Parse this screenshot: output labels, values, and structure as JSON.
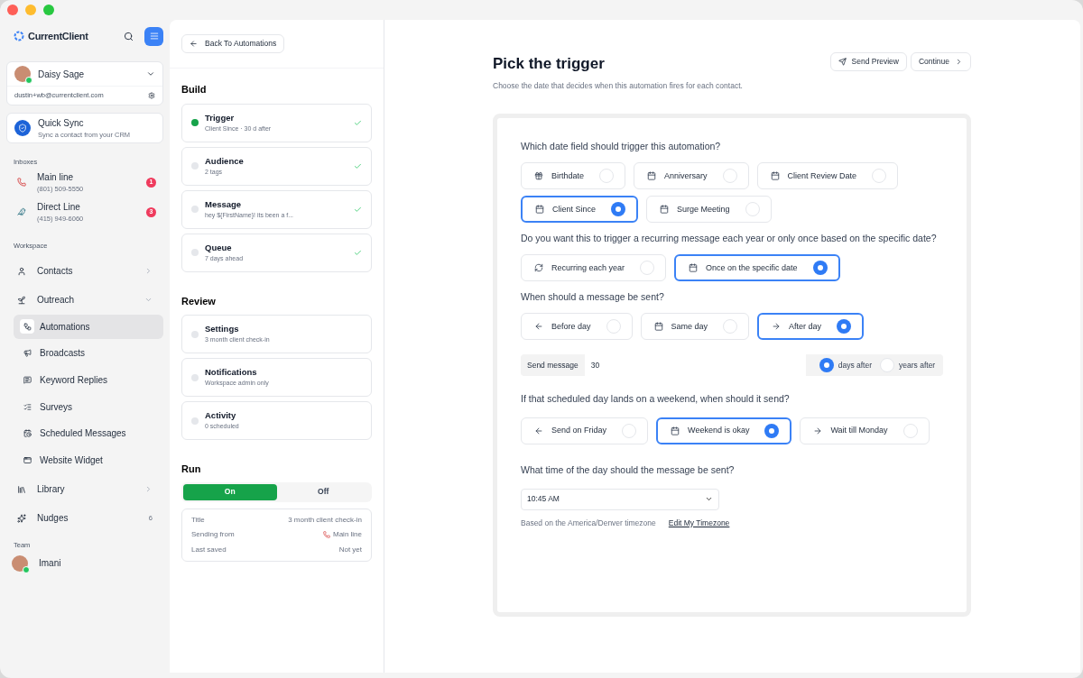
{
  "brand": {
    "name": "CurrentClient"
  },
  "account": {
    "name": "Daisy Sage",
    "email": "dustin+wb@currentclient.com",
    "online": true
  },
  "quick_sync": {
    "title": "Quick Sync",
    "subtitle": "Sync a contact from your CRM"
  },
  "inboxes": {
    "heading": "Inboxes",
    "items": [
      {
        "name": "Main line",
        "phone": "(801) 509-5550",
        "count": "1"
      },
      {
        "name": "Direct Line",
        "phone": "(415) 949-6060",
        "count": "3"
      }
    ]
  },
  "workspace": {
    "heading": "Workspace",
    "items": [
      {
        "label": "Contacts",
        "expanded": false
      },
      {
        "label": "Outreach",
        "expanded": true,
        "children": [
          {
            "label": "Automations",
            "selected": true
          },
          {
            "label": "Broadcasts",
            "selected": false
          },
          {
            "label": "Keyword Replies",
            "selected": false
          },
          {
            "label": "Surveys",
            "selected": false
          },
          {
            "label": "Scheduled Messages",
            "selected": false
          },
          {
            "label": "Website Widget",
            "selected": false
          }
        ]
      },
      {
        "label": "Library",
        "expanded": false
      },
      {
        "label": "Nudges",
        "count": "6"
      }
    ]
  },
  "team": {
    "heading": "Team",
    "members": [
      {
        "name": "Imani",
        "online": true
      }
    ]
  },
  "steps_panel": {
    "back_button": "Back To Automations",
    "sections": [
      {
        "title": "Build",
        "items": [
          {
            "title": "Trigger",
            "subtitle": "Client Since · 30 d after",
            "active": true,
            "done": true
          },
          {
            "title": "Audience",
            "subtitle": "2 tags",
            "active": false,
            "done": true
          },
          {
            "title": "Message",
            "subtitle": "hey ${FirstName}! its been a f...",
            "active": false,
            "done": true
          },
          {
            "title": "Queue",
            "subtitle": "7 days ahead",
            "active": false,
            "done": true
          }
        ]
      },
      {
        "title": "Review",
        "items": [
          {
            "title": "Settings",
            "subtitle": "3 month client check-in",
            "active": false,
            "done": false
          },
          {
            "title": "Notifications",
            "subtitle": "Workspace admin only",
            "active": false,
            "done": false
          },
          {
            "title": "Activity",
            "subtitle": "0 scheduled",
            "active": false,
            "done": false
          }
        ]
      }
    ],
    "run": {
      "title": "Run",
      "options": [
        {
          "label": "On",
          "selected": true
        },
        {
          "label": "Off",
          "selected": false
        }
      ],
      "details": [
        {
          "label": "Title",
          "value": "3 month client check-in",
          "inbox_icon": false
        },
        {
          "label": "Sending from",
          "value": "Main line",
          "inbox_icon": true
        },
        {
          "label": "Last saved",
          "value": "Not yet",
          "inbox_icon": false
        }
      ]
    }
  },
  "main": {
    "title": "Pick the trigger",
    "subtitle": "Choose the date that decides when this automation fires for each contact.",
    "buttons": [
      "Send Preview",
      "Continue"
    ],
    "questions": [
      {
        "text": "Which date field should trigger this automation?",
        "options": [
          {
            "label": "Birthdate",
            "selected": false
          },
          {
            "label": "Anniversary",
            "selected": false
          },
          {
            "label": "Client Review Date",
            "selected": false
          },
          {
            "label": "Client Since",
            "selected": true
          },
          {
            "label": "Surge Meeting",
            "selected": false
          }
        ]
      },
      {
        "text": "Do you want this to trigger a recurring message each year or only once based on the specific date?",
        "options": [
          {
            "label": "Recurring each year",
            "selected": false
          },
          {
            "label": "Once on the specific date",
            "selected": true
          }
        ]
      },
      {
        "text": "When should a message be sent?",
        "options": [
          {
            "label": "Before day",
            "selected": false
          },
          {
            "label": "Same day",
            "selected": false
          },
          {
            "label": "After day",
            "selected": true
          }
        ]
      }
    ],
    "send_message": {
      "label": "Send message",
      "value": "30",
      "units": [
        {
          "label": "days after",
          "selected": true
        },
        {
          "label": "years after",
          "selected": false
        }
      ]
    },
    "weekend": {
      "text": "If that scheduled day lands on a weekend, when should it send?",
      "options": [
        {
          "label": "Send on Friday",
          "selected": false
        },
        {
          "label": "Weekend is okay",
          "selected": true
        },
        {
          "label": "Wait till Monday",
          "selected": false
        }
      ]
    },
    "time": {
      "text": "What time of the day should the message be sent?",
      "value": "10:45 AM",
      "note": "Based on the America/Denver timezone",
      "link": "Edit My Timezone"
    }
  }
}
